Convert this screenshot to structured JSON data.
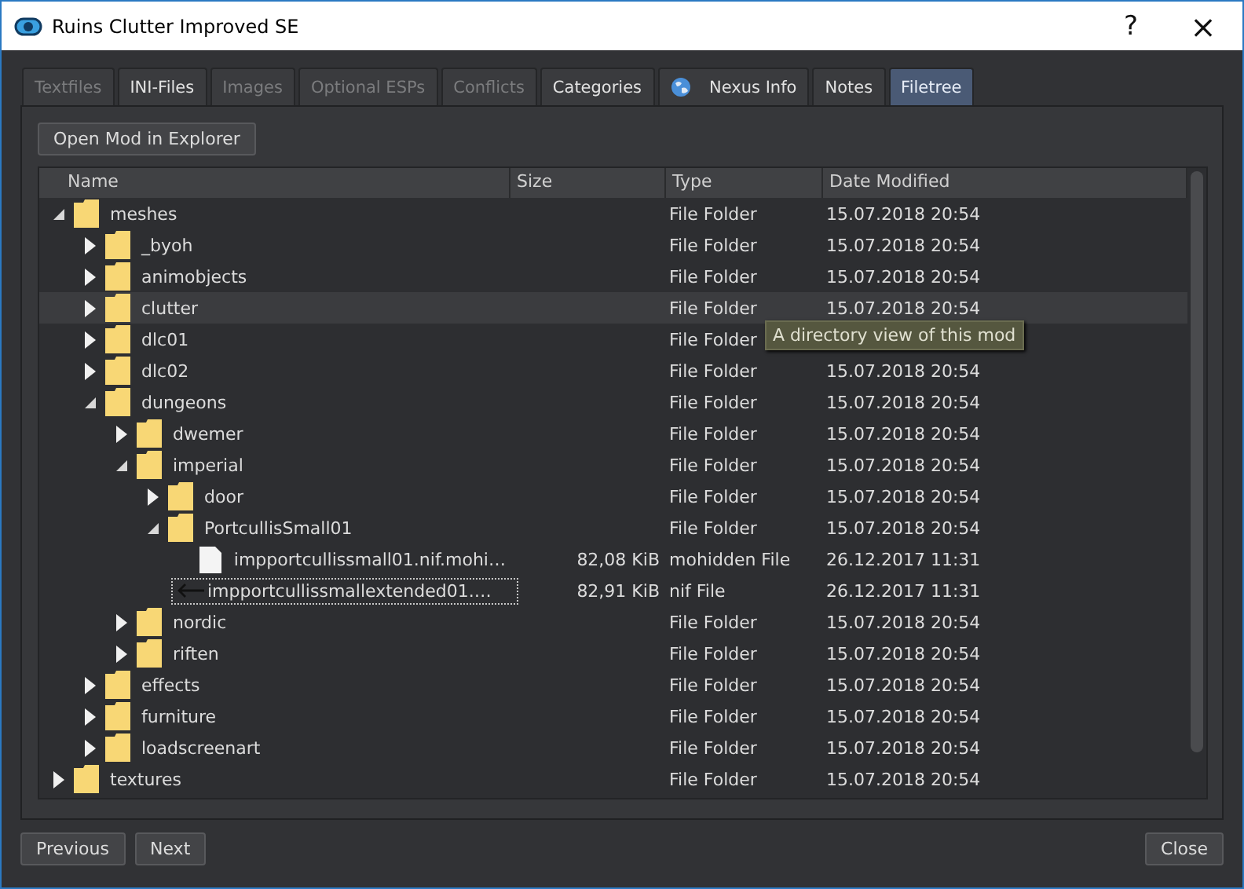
{
  "window": {
    "title": "Ruins Clutter Improved SE",
    "buttons": [
      "?",
      "×"
    ]
  },
  "tabs": [
    {
      "label": "Textfiles",
      "selected": false,
      "disabled": true
    },
    {
      "label": "INI-Files",
      "selected": false,
      "disabled": false
    },
    {
      "label": "Images",
      "selected": false,
      "disabled": true
    },
    {
      "label": "Optional ESPs",
      "selected": false,
      "disabled": true
    },
    {
      "label": "Conflicts",
      "selected": false,
      "disabled": true
    },
    {
      "label": "Categories",
      "selected": false,
      "disabled": false
    },
    {
      "label": "Nexus Info",
      "selected": false,
      "disabled": false,
      "kind": "globe"
    },
    {
      "label": "Notes",
      "selected": false,
      "disabled": false
    },
    {
      "label": "Filetree",
      "selected": true,
      "disabled": false
    }
  ],
  "open_button": "Open Mod in Explorer",
  "tree": {
    "columns": [
      "Name",
      "Size",
      "Type",
      "Date Modified"
    ],
    "items": [
      {
        "name": "meshes",
        "kind": "folder",
        "type": "File Folder",
        "date": "15.07.2018 20:54",
        "expanded": true,
        "hovered": false,
        "focused": false,
        "children": [
          {
            "name": "_byoh",
            "kind": "folder",
            "type": "File Folder",
            "date": "15.07.2018 20:54",
            "expanded": false,
            "hovered": false,
            "focused": false
          },
          {
            "name": "animobjects",
            "kind": "folder",
            "type": "File Folder",
            "date": "15.07.2018 20:54",
            "expanded": false,
            "hovered": false,
            "focused": false
          },
          {
            "name": "clutter",
            "kind": "folder",
            "type": "File Folder",
            "date": "15.07.2018 20:54",
            "expanded": false,
            "hovered": true,
            "focused": false
          },
          {
            "name": "dlc01",
            "kind": "folder",
            "type": "File Folder",
            "expanded": false,
            "hovered": false,
            "focused": false
          },
          {
            "name": "dlc02",
            "kind": "folder",
            "type": "File Folder",
            "date": "15.07.2018 20:54",
            "expanded": false,
            "hovered": false,
            "focused": false
          },
          {
            "name": "dungeons",
            "kind": "folder",
            "type": "File Folder",
            "date": "15.07.2018 20:54",
            "expanded": true,
            "hovered": false,
            "focused": false,
            "children": [
              {
                "name": "dwemer",
                "kind": "folder",
                "type": "File Folder",
                "date": "15.07.2018 20:54",
                "expanded": false,
                "hovered": false,
                "focused": false
              },
              {
                "name": "imperial",
                "kind": "folder",
                "type": "File Folder",
                "date": "15.07.2018 20:54",
                "expanded": true,
                "hovered": false,
                "focused": false,
                "children": [
                  {
                    "name": "door",
                    "kind": "folder",
                    "type": "File Folder",
                    "date": "15.07.2018 20:54",
                    "expanded": false,
                    "hovered": false,
                    "focused": false
                  },
                  {
                    "name": "PortcullisSmall01",
                    "kind": "folder",
                    "type": "File Folder",
                    "date": "15.07.2018 20:54",
                    "expanded": true,
                    "hovered": false,
                    "focused": false,
                    "children": [
                      {
                        "name": "impportcullissmall01.nif.mohi…",
                        "kind": "file",
                        "size": "82,08 KiB",
                        "type": "mohidden File",
                        "date": "26.12.2017 11:31",
                        "hovered": false,
                        "focused": false
                      },
                      {
                        "name": "impportcullissmallextended01.…",
                        "kind": "arrow-file",
                        "size": "82,91 KiB",
                        "type": "nif File",
                        "date": "26.12.2017 11:31",
                        "hovered": false,
                        "focused": true
                      }
                    ]
                  }
                ]
              },
              {
                "name": "nordic",
                "kind": "folder",
                "type": "File Folder",
                "date": "15.07.2018 20:54",
                "expanded": false,
                "hovered": false,
                "focused": false
              },
              {
                "name": "riften",
                "kind": "folder",
                "type": "File Folder",
                "date": "15.07.2018 20:54",
                "expanded": false,
                "hovered": false,
                "focused": false
              }
            ]
          },
          {
            "name": "effects",
            "kind": "folder",
            "type": "File Folder",
            "date": "15.07.2018 20:54",
            "expanded": false,
            "hovered": false,
            "focused": false
          },
          {
            "name": "furniture",
            "kind": "folder",
            "type": "File Folder",
            "date": "15.07.2018 20:54",
            "expanded": false,
            "hovered": false,
            "focused": false
          },
          {
            "name": "loadscreenart",
            "kind": "folder",
            "type": "File Folder",
            "date": "15.07.2018 20:54",
            "expanded": false,
            "hovered": false,
            "focused": false
          }
        ]
      },
      {
        "name": "textures",
        "kind": "folder",
        "type": "File Folder",
        "date": "15.07.2018 20:54",
        "expanded": false,
        "hovered": false,
        "focused": false
      }
    ]
  },
  "tooltip": "A directory view of this mod",
  "footer": {
    "left_buttons": [
      "Previous",
      "Next"
    ],
    "right_button": "Close"
  }
}
